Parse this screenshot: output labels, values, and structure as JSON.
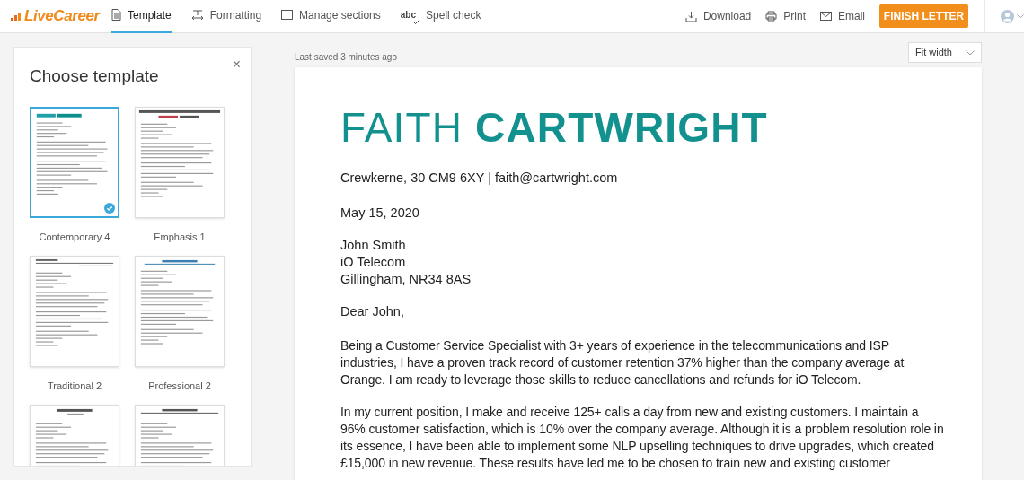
{
  "header": {
    "logo": "LiveCareer",
    "tabs": [
      {
        "label": "Template",
        "kind": "document",
        "selected": true
      },
      {
        "label": "Formatting",
        "kind": "formatting",
        "selected": false
      },
      {
        "label": "Manage sections",
        "kind": "columns",
        "selected": false
      },
      {
        "label": "Spell check",
        "kind": "abc",
        "icon_text": "abc",
        "selected": false
      }
    ],
    "actions": [
      {
        "label": "Download",
        "kind": "download"
      },
      {
        "label": "Print",
        "kind": "print"
      },
      {
        "label": "Email",
        "kind": "mail"
      }
    ],
    "primary_button": "FINISH LETTER"
  },
  "template_panel": {
    "title": "Choose template",
    "close": "×",
    "templates": [
      {
        "name": "Contemporary 4",
        "kind": "contemporary",
        "selected": true
      },
      {
        "name": "Emphasis 1",
        "kind": "emphasis",
        "selected": false
      },
      {
        "name": "Traditional 2",
        "kind": "traditional",
        "selected": false
      },
      {
        "name": "Professional 2",
        "kind": "professional",
        "selected": false
      },
      {
        "kind": "centered",
        "selected": false
      },
      {
        "kind": "ruled",
        "selected": false
      }
    ]
  },
  "editor": {
    "last_saved": "Last saved 3 minutes ago",
    "zoom": "Fit width",
    "letter": {
      "first_name": "FAITH",
      "last_name": "CARTWRIGHT",
      "contact": "Crewkerne, 30 CM9 6XY | faith@cartwright.com",
      "date": "May 15, 2020",
      "recipient": [
        "John Smith",
        "iO Telecom",
        "Gillingham, NR34 8AS"
      ],
      "greeting": "Dear John,",
      "paragraphs": [
        "Being a Customer Service Specialist with 3+ years of experience in the telecommunications and ISP industries, I have a proven track record of customer retention 37% higher than the company average at Orange. I am ready to leverage those skills to reduce cancellations and refunds for iO Telecom.",
        "In my current position, I make and receive 125+ calls a day from new and existing customers. I maintain a 96% customer satisfaction, which is 10% over the company average. Although it is a problem resolution role in its essence, I have been able to implement some NLP upselling techniques to drive upgrades, which created £15,000 in new revenue. These results have led me to be chosen to train new and existing customer"
      ]
    }
  }
}
